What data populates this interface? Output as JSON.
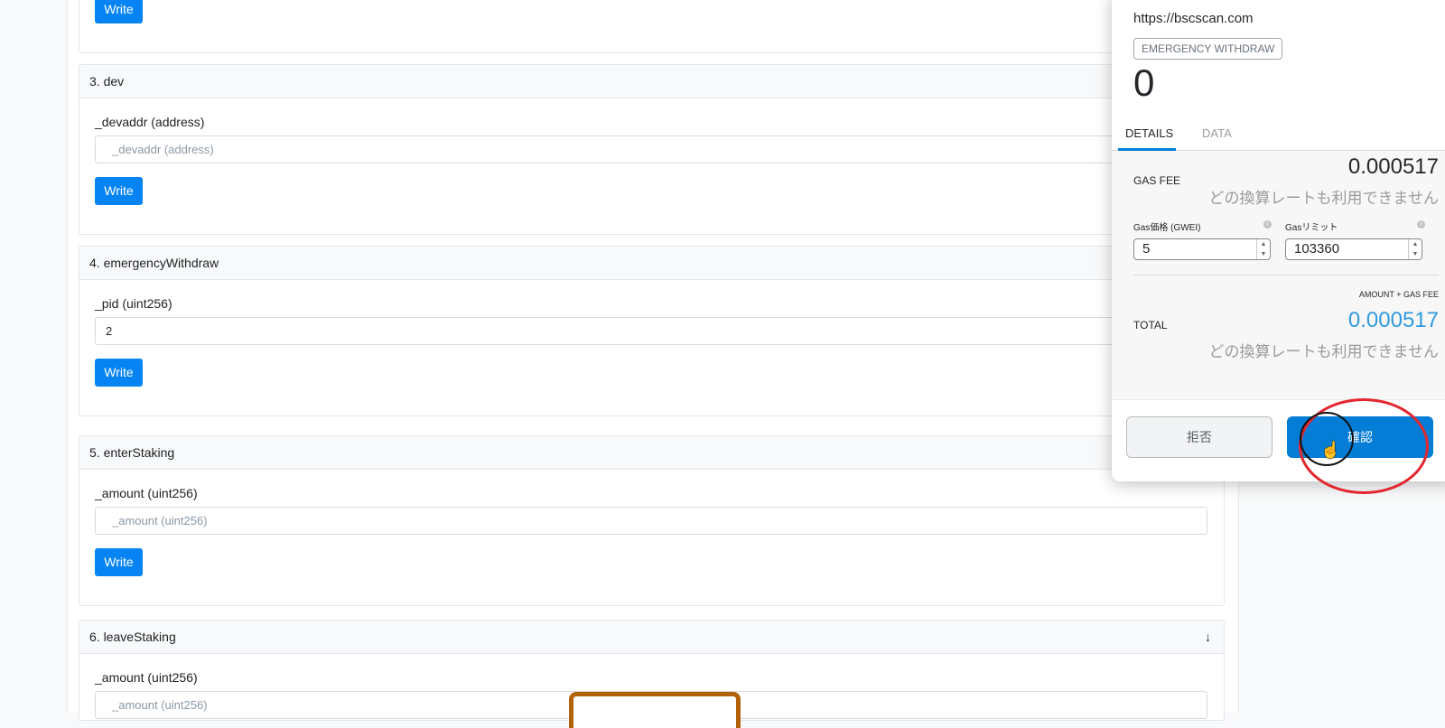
{
  "contract": {
    "top_write_label": "Write",
    "cards": [
      {
        "header": "3. dev",
        "param_label": "_devaddr (address)",
        "placeholder": "_devaddr (address)",
        "value": "",
        "write_label": "Write"
      },
      {
        "header": "4. emergencyWithdraw",
        "param_label": "_pid (uint256)",
        "placeholder": "",
        "value": "2",
        "write_label": "Write"
      },
      {
        "header": "5. enterStaking",
        "param_label": "_amount (uint256)",
        "placeholder": "_amount (uint256)",
        "value": "",
        "write_label": "Write"
      },
      {
        "header": "6. leaveStaking",
        "param_label": "_amount (uint256)",
        "placeholder": "_amount (uint256)",
        "value": "",
        "arrow": "↓"
      }
    ]
  },
  "metamask": {
    "origin": "https://bscscan.com",
    "action": "EMERGENCY WITHDRAW",
    "amount": "0",
    "tabs": [
      "DETAILS",
      "DATA"
    ],
    "gas_fee_label": "GAS FEE",
    "gas_fee_value": "0.000517",
    "conversion_note": "どの換算レートも利用できません",
    "gas_price_label": "Gas価格 (GWEI)",
    "gas_price_value": "5",
    "gas_limit_label": "Gasリミット",
    "gas_limit_value": "103360",
    "amount_gas_label": "AMOUNT + GAS FEE",
    "total_label": "TOTAL",
    "total_value": "0.000517",
    "total_note": "どの換算レートも利用できません",
    "reject_label": "拒否",
    "confirm_label": "確認"
  },
  "colors": {
    "accent": "#037dd6",
    "write_button": "#0784f3",
    "annotation": "#e3262f",
    "stamp": "#b3620a"
  }
}
